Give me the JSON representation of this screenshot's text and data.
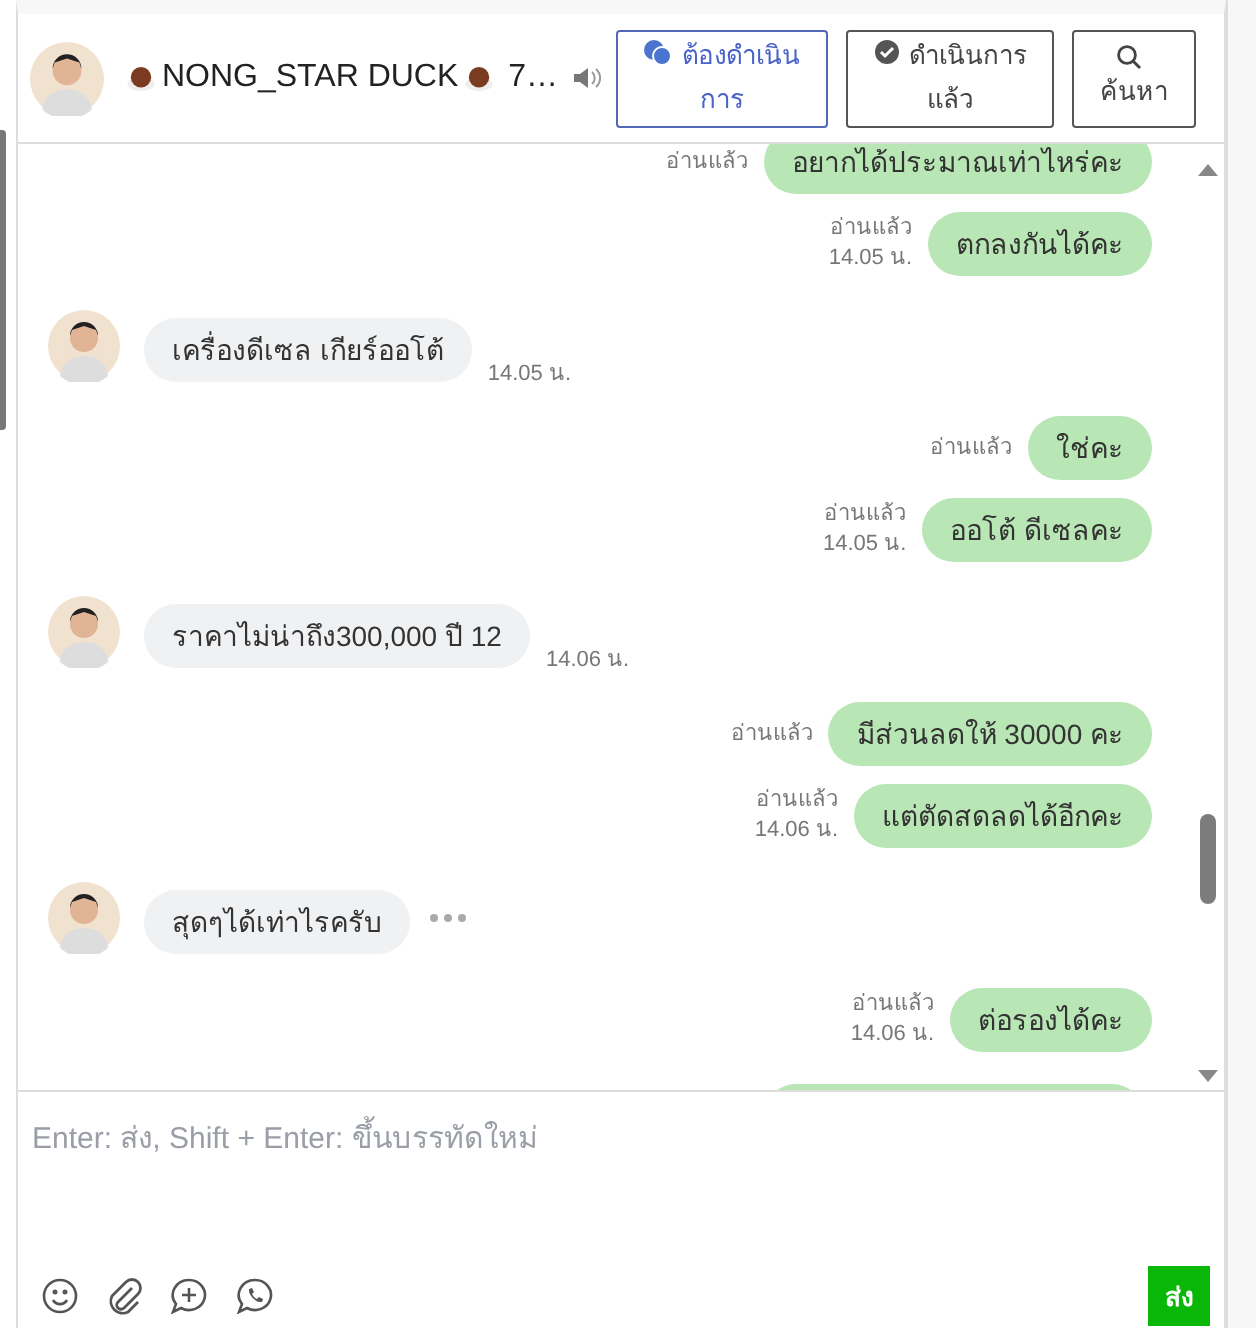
{
  "header": {
    "title": "NONG_STAR DUCK",
    "title_suffix": "7…",
    "buttons": [
      {
        "label": "ต้องดำเนินการ",
        "kind": "todo",
        "selected": true
      },
      {
        "label": "ดำเนินการแล้ว",
        "kind": "done",
        "selected": false
      },
      {
        "label": "ค้นหา",
        "kind": "search",
        "selected": false
      }
    ]
  },
  "messages": [
    {
      "kind": "outgoing",
      "text": "อยากได้ประมาณเท่าไหร่คะ",
      "read": "อ่านแล้ว",
      "typing": false
    },
    {
      "kind": "outgoing",
      "text": "ตกลงกันได้คะ",
      "read": "อ่านแล้ว",
      "time": "14.05 น.",
      "typing": false
    },
    {
      "kind": "incoming",
      "text": "เครื่องดีเซล เกียร์ออโต้",
      "time": "14.05 น.",
      "typing": false
    },
    {
      "kind": "outgoing",
      "text": "ใช่คะ",
      "read": "อ่านแล้ว",
      "typing": false
    },
    {
      "kind": "outgoing",
      "text": "ออโต้ ดีเซลคะ",
      "read": "อ่านแล้ว",
      "time": "14.05 น.",
      "typing": false
    },
    {
      "kind": "incoming",
      "text": "ราคาไม่น่าถึง300,000 ปี 12",
      "time": "14.06 น.",
      "typing": false
    },
    {
      "kind": "outgoing",
      "text": "มีส่วนลดให้ 30000 คะ",
      "read": "อ่านแล้ว",
      "typing": false
    },
    {
      "kind": "outgoing",
      "text": "แต่ตัดสดลดได้อีกคะ",
      "read": "อ่านแล้ว",
      "time": "14.06 น.",
      "typing": false
    },
    {
      "kind": "incoming",
      "text": "สุดๆได้เท่าไรครับ",
      "typing": true
    },
    {
      "kind": "outgoing",
      "text": "ต่อรองได้คะ",
      "read": "อ่านแล้ว",
      "time": "14.06 น.",
      "typing": false
    },
    {
      "kind": "clipped",
      "typing": false
    }
  ],
  "composer": {
    "placeholder": "Enter: ส่ง, Shift + Enter: ขึ้นบรรทัดใหม่",
    "send": "ส่ง"
  }
}
